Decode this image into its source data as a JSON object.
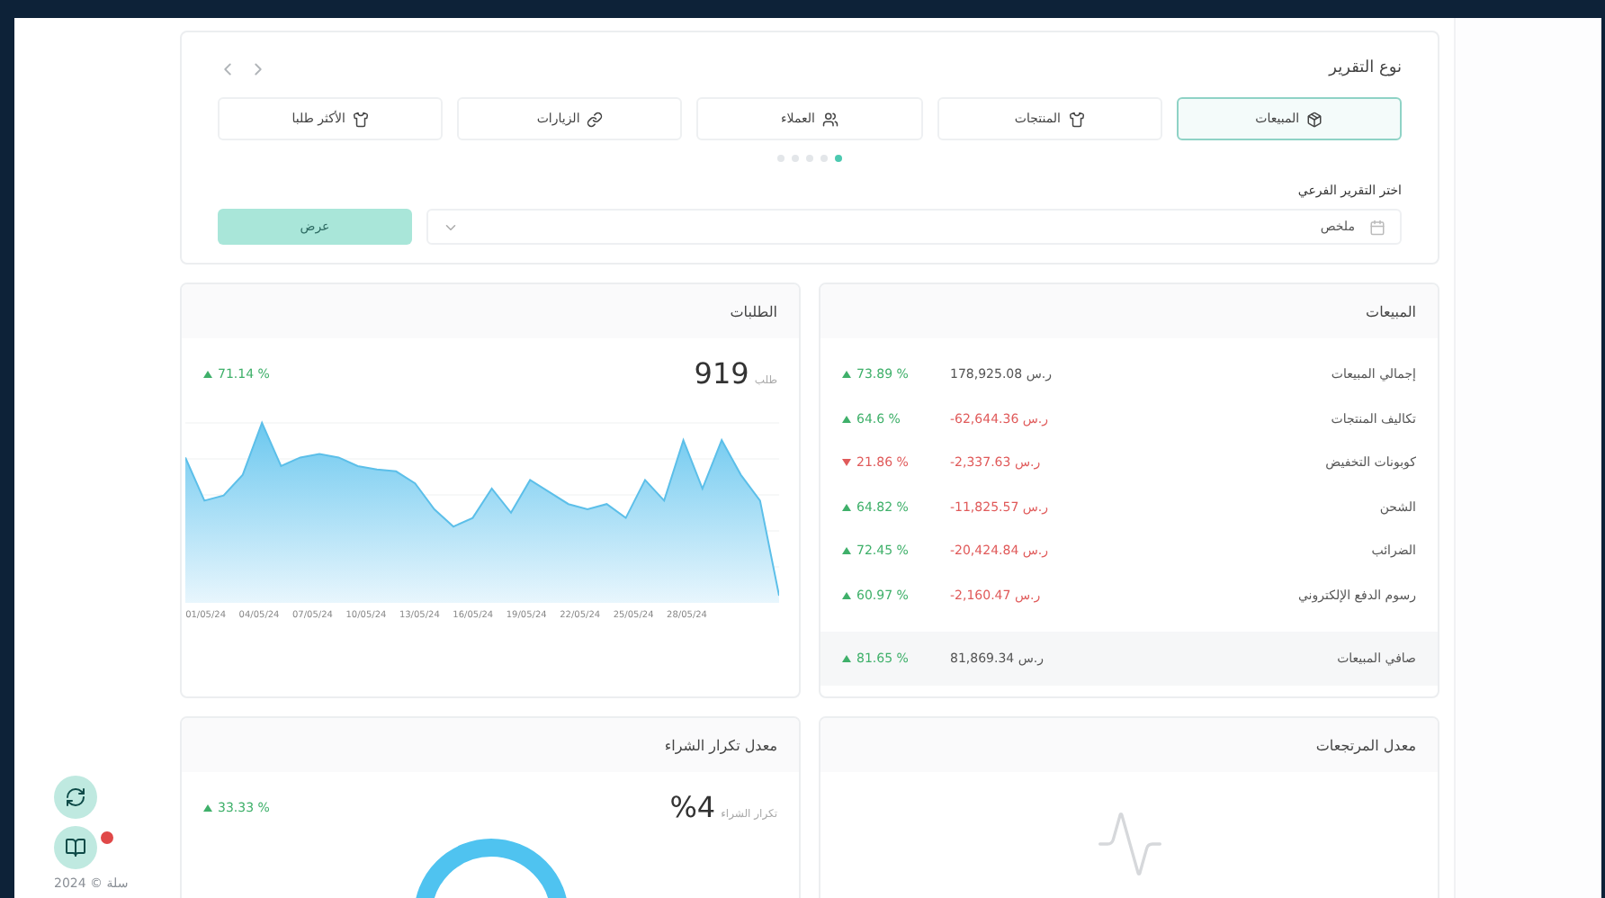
{
  "report_type": {
    "title": "نوع التقرير",
    "tabs": [
      {
        "label": "المبيعات",
        "selected": true
      },
      {
        "label": "المنتجات",
        "selected": false
      },
      {
        "label": "العملاء",
        "selected": false
      },
      {
        "label": "الزيارات",
        "selected": false
      },
      {
        "label": "الأكثر طلبا",
        "selected": false
      }
    ],
    "pager_dots": [
      {
        "selected": true
      },
      {
        "selected": false
      },
      {
        "selected": false
      },
      {
        "selected": false
      },
      {
        "selected": false
      }
    ],
    "sub_report_label": "اختر التقرير الفرعي",
    "sub_report_value": "ملخص",
    "show_button": "عرض"
  },
  "sales": {
    "title": "المبيعات",
    "rows": [
      {
        "label": "إجمالي المبيعات",
        "value": "178,925.08 ر.س",
        "negative": false,
        "change": "73.89 %",
        "rising": true
      },
      {
        "label": "تكاليف المنتجات",
        "value": "-62,644.36 ر.س",
        "negative": true,
        "change": "64.6 %",
        "rising": true
      },
      {
        "label": "كوبونات التخفيض",
        "value": "-2,337.63 ر.س",
        "negative": true,
        "change": "21.86 %",
        "rising": false
      },
      {
        "label": "الشحن",
        "value": "-11,825.57 ر.س",
        "negative": true,
        "change": "64.82 %",
        "rising": true
      },
      {
        "label": "الضرائب",
        "value": "-20,424.84 ر.س",
        "negative": true,
        "change": "72.45 %",
        "rising": true
      },
      {
        "label": "رسوم الدفع الإلكتروني",
        "value": "-2,160.47 ر.س",
        "negative": true,
        "change": "60.97 %",
        "rising": true
      }
    ],
    "total": {
      "label": "صافي المبيعات",
      "value": "81,869.34 ر.س",
      "negative": false,
      "change": "81.65 %",
      "rising": true
    }
  },
  "orders": {
    "title": "الطلبات",
    "count": "919",
    "unit": "طلب",
    "change": "71.14 %",
    "rising": true,
    "x_labels": [
      "28/05/24",
      "25/05/24",
      "22/05/24",
      "19/05/24",
      "16/05/24",
      "13/05/24",
      "10/05/24",
      "07/05/24",
      "04/05/24",
      "01/05/24"
    ]
  },
  "returns": {
    "title": "معدل المرتجعات"
  },
  "repeat_purchase": {
    "title": "معدل تكرار الشراء",
    "value": "%4",
    "caption": "تكرار الشراء",
    "change": "33.33 %",
    "rising": true
  },
  "footer": {
    "copyright": "2024 © سلة"
  }
}
